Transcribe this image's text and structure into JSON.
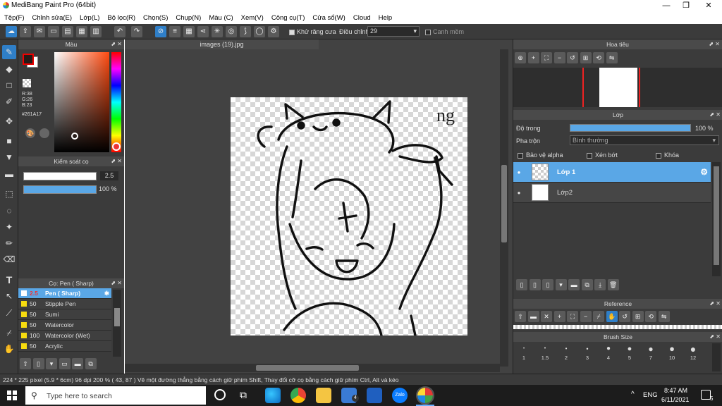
{
  "window": {
    "title": "MediBang Paint Pro (64bit)",
    "minimize": "—",
    "maximize": "❐",
    "close": "✕"
  },
  "menu": [
    "Tệp(F)",
    "Chỉnh sửa(E)",
    "Lớp(L)",
    "Bộ lọc(R)",
    "Chọn(S)",
    "Chụp(N)",
    "Màu (C)",
    "Xem(V)",
    "Công cụ(T)",
    "Cửa sổ(W)",
    "Cloud",
    "Help"
  ],
  "toolbar": {
    "antialias_label": "Khử răng cưa",
    "adjust_label": "Điều chỉnh",
    "adjust_value": "29",
    "snap_label": "Canh mềm"
  },
  "color_panel": {
    "title": "Màu",
    "r": "R:38",
    "g": "G:26",
    "b": "B:23",
    "hex": "#261A17",
    "fg_color": "#261A17",
    "bg_color": "#ffffff"
  },
  "brush_control": {
    "title": "Kiểm soát cọ",
    "size": "2.5",
    "opacity": "100 %"
  },
  "brush_list": {
    "title": "Cọ: Pen ( Sharp)",
    "items": [
      {
        "size": "2.5",
        "name": "Pen ( Sharp)",
        "selected": true
      },
      {
        "size": "50",
        "name": "Stipple Pen"
      },
      {
        "size": "50",
        "name": "Sumi"
      },
      {
        "size": "50",
        "name": "Watercolor"
      },
      {
        "size": "100",
        "name": "Watercolor (Wet)"
      },
      {
        "size": "50",
        "name": "Acrylic"
      }
    ]
  },
  "canvas": {
    "tab_title": "images (19).jpg",
    "sketch_text": "ng"
  },
  "navigator": {
    "title": "Hoa tiêu"
  },
  "layer_panel": {
    "title": "Lớp",
    "opacity_label": "Độ trong",
    "opacity_value": "100 %",
    "opacity_fraction": 1.0,
    "blend_label": "Pha trộn",
    "blend_value": "Bình thường",
    "protect_alpha": "Bảo vệ alpha",
    "clipping": "Xén bớt",
    "lock": "Khóa",
    "layers": [
      {
        "name": "Lớp 1",
        "selected": true
      },
      {
        "name": "Lớp2",
        "selected": false
      }
    ]
  },
  "reference": {
    "title": "Reference"
  },
  "brush_size": {
    "title": "Brush Size",
    "sizes": [
      "1",
      "1.5",
      "2",
      "3",
      "4",
      "5",
      "7",
      "10",
      "12"
    ]
  },
  "status": {
    "text": "224 * 225 pixel   (5.9 * 6cm)   96 dpi   200 %   ( 43, 87 )   Vẽ một đường thẳng bằng cách giữ phím Shift, Thay đổi cỡ cọ bằng cách giữ phím Ctrl, Alt và kéo"
  },
  "taskbar": {
    "search_placeholder": "Type here to search",
    "lang": "ENG",
    "time": "8:47 AM",
    "date": "6/11/2021",
    "mail_badge": "4",
    "notif_count": "5",
    "zalo_label": "Zalo"
  }
}
